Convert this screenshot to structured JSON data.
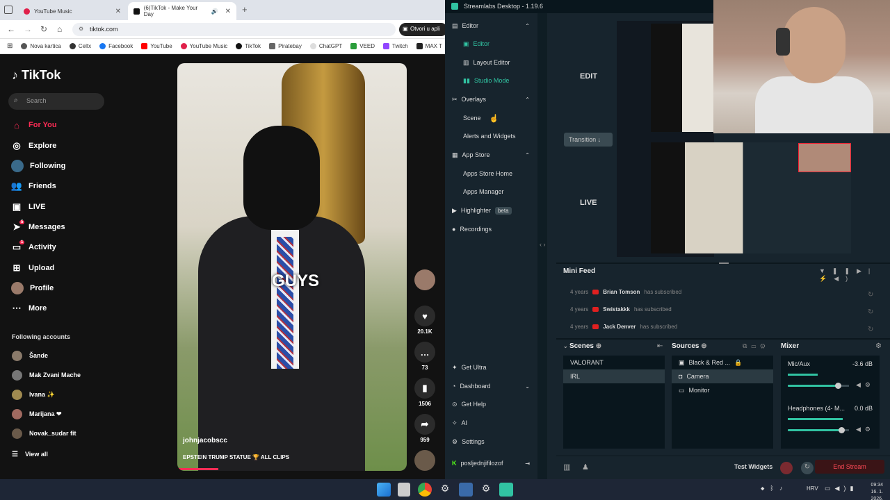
{
  "browser": {
    "tabs": [
      {
        "title": "YouTube Music",
        "icon": "youtube-music-icon"
      },
      {
        "title": "(6)TikTok - Make Your Day",
        "icon": "tiktok-icon"
      }
    ],
    "url": "tiktok.com",
    "open_app": "Otvori u apli",
    "bookmarks": [
      "Nova kartica",
      "Celtx",
      "Facebook",
      "YouTube",
      "YouTube Music",
      "TikTok",
      "Piratebay",
      "ChatGPT",
      "VEED",
      "Twitch",
      "MAX T"
    ]
  },
  "tiktok": {
    "logo": "TikTok",
    "search_placeholder": "Search",
    "nav": [
      {
        "label": "For You",
        "icon": "home-icon",
        "active": true
      },
      {
        "label": "Explore",
        "icon": "compass-icon"
      },
      {
        "label": "Following",
        "icon": "following-icon"
      },
      {
        "label": "Friends",
        "icon": "friends-icon"
      },
      {
        "label": "LIVE",
        "icon": "live-icon"
      },
      {
        "label": "Messages",
        "icon": "messages-icon",
        "badge": "5"
      },
      {
        "label": "Activity",
        "icon": "activity-icon",
        "badge": "1"
      },
      {
        "label": "Upload",
        "icon": "upload-icon"
      },
      {
        "label": "Profile",
        "icon": "profile-icon"
      },
      {
        "label": "More",
        "icon": "more-icon"
      }
    ],
    "following_title": "Following accounts",
    "accounts": [
      "Šande",
      "Mak Zvani Mache",
      "Ivana ✨",
      "Marijana ❤",
      "Novak_sudar fit"
    ],
    "view_all": "View all",
    "video": {
      "caption_overlay": "GUYS",
      "author": "johnjacobscc",
      "description": "EPSTEIN TRUMP STATUE 🏆 ALL CLIPS",
      "likes": "20.1K",
      "comments": "73",
      "saves": "1506",
      "shares": "959",
      "progress": 0.18
    }
  },
  "streamlabs": {
    "title": "Streamlabs Desktop - 1.19.6",
    "nav": {
      "editor_section": "Editor",
      "editor": "Editor",
      "layout_editor": "Layout Editor",
      "studio_mode": "Studio Mode",
      "overlays_section": "Overlays",
      "scene": "Scene",
      "alerts": "Alerts and Widgets",
      "app_store_section": "App Store",
      "apps_store_home": "Apps Store Home",
      "apps_manager": "Apps Manager",
      "highlighter": "Highlighter",
      "beta": "beta",
      "recordings": "Recordings",
      "get_ultra": "Get Ultra",
      "dashboard": "Dashboard",
      "get_help": "Get Help",
      "ai": "AI",
      "settings": "Settings",
      "account": "posljednjifilozof"
    },
    "studio": {
      "edit": "EDIT",
      "live": "LIVE",
      "transition": "Transition ↓"
    },
    "minifeed": {
      "title": "Mini Feed",
      "events": [
        {
          "age": "4 years",
          "name": "Brian Tomson",
          "action": "has subscribed"
        },
        {
          "age": "4 years",
          "name": "Swistakkk",
          "action": "has subscribed"
        },
        {
          "age": "4 years",
          "name": "Jack Denver",
          "action": "has subscribed"
        }
      ]
    },
    "scenes": {
      "title": "Scenes",
      "items": [
        "VALORANT",
        "IRL"
      ],
      "selected": "IRL"
    },
    "sources": {
      "title": "Sources",
      "items": [
        "Black & Red ...",
        "Camera",
        "Monitor"
      ],
      "selected": "Camera"
    },
    "mixer": {
      "title": "Mixer",
      "channels": [
        {
          "name": "Mic/Aux",
          "db": "-3.6 dB",
          "level": 0.36,
          "volume": 0.82
        },
        {
          "name": "Headphones (4- M...",
          "db": "0.0 dB",
          "level": 0.66,
          "volume": 0.88
        }
      ]
    },
    "footer": {
      "test_widgets": "Test Widgets",
      "end_stream": "End Stream"
    },
    "colors": {
      "accent": "#31c3a2",
      "danger": "#ff4a57"
    }
  },
  "taskbar": {
    "lang": "HRV",
    "time": "09:34",
    "date": "16. 1. 2026."
  }
}
